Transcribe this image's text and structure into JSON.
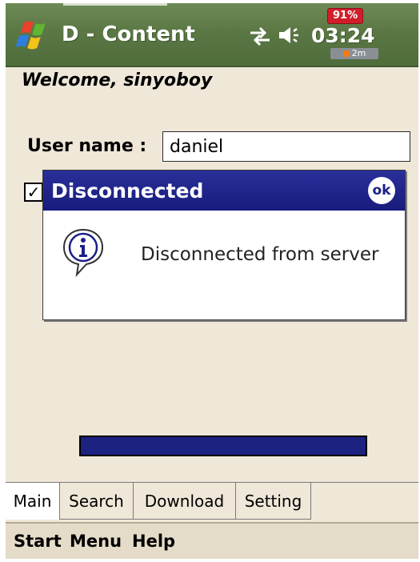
{
  "status_bar": {
    "app_title": "D - Content",
    "clock": "03:24",
    "battery": "91%",
    "time_remaining": "2m"
  },
  "main": {
    "welcome": "Welcome, sinyoboy",
    "username_label": "User name :",
    "username_value": "daniel",
    "remember_checked": true,
    "progress_fraction": 1.0
  },
  "dialog": {
    "title": "Disconnected",
    "ok_label": "ok",
    "message": "Disconnected from server",
    "icon": "info-speech-bubble-icon"
  },
  "tabs": [
    {
      "label": "Main",
      "active": true
    },
    {
      "label": "Search",
      "active": false
    },
    {
      "label": "Download",
      "active": false
    },
    {
      "label": "Setting",
      "active": false
    }
  ],
  "menu": {
    "start": "Start",
    "menu": "Menu",
    "help": "Help"
  },
  "colors": {
    "titlebar": "#5a7744",
    "dialog_titlebar": "#1b2086",
    "progress": "#1c2280",
    "background": "#efe7d8"
  }
}
